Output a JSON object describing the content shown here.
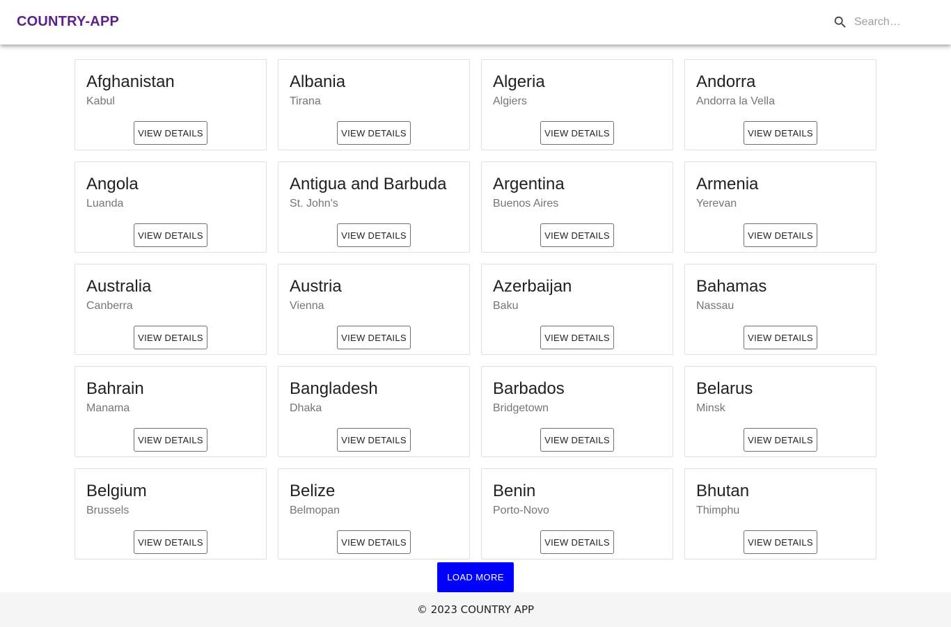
{
  "header": {
    "brand": "COUNTRY-APP",
    "search_placeholder": "Search…",
    "search_icon": "search-icon"
  },
  "countries": [
    {
      "name": "Afghanistan",
      "capital": "Kabul"
    },
    {
      "name": "Albania",
      "capital": "Tirana"
    },
    {
      "name": "Algeria",
      "capital": "Algiers"
    },
    {
      "name": "Andorra",
      "capital": "Andorra la Vella"
    },
    {
      "name": "Angola",
      "capital": "Luanda"
    },
    {
      "name": "Antigua and Barbuda",
      "capital": "St. John's"
    },
    {
      "name": "Argentina",
      "capital": "Buenos Aires"
    },
    {
      "name": "Armenia",
      "capital": "Yerevan"
    },
    {
      "name": "Australia",
      "capital": "Canberra"
    },
    {
      "name": "Austria",
      "capital": "Vienna"
    },
    {
      "name": "Azerbaijan",
      "capital": "Baku"
    },
    {
      "name": "Bahamas",
      "capital": "Nassau"
    },
    {
      "name": "Bahrain",
      "capital": "Manama"
    },
    {
      "name": "Bangladesh",
      "capital": "Dhaka"
    },
    {
      "name": "Barbados",
      "capital": "Bridgetown"
    },
    {
      "name": "Belarus",
      "capital": "Minsk"
    },
    {
      "name": "Belgium",
      "capital": "Brussels"
    },
    {
      "name": "Belize",
      "capital": "Belmopan"
    },
    {
      "name": "Benin",
      "capital": "Porto-Novo"
    },
    {
      "name": "Bhutan",
      "capital": "Thimphu"
    }
  ],
  "card_button_label": "VIEW DETAILS",
  "load_more_label": "LOAD MORE",
  "footer": {
    "text": "© 2023 COUNTRY APP"
  },
  "colors": {
    "brand": "#5b1f8f",
    "load_more_bg": "#0000ff",
    "footer_bg": "#f5f5f5"
  }
}
